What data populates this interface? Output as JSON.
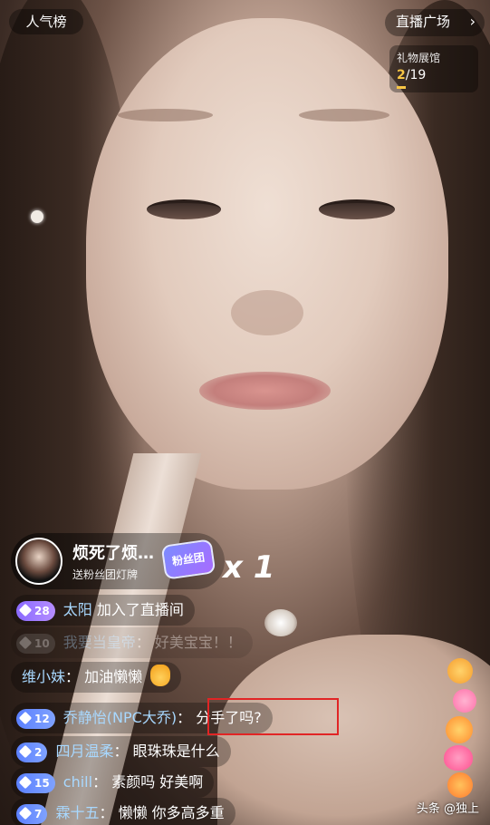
{
  "header": {
    "rank_label": "人气榜",
    "plaza_label": "直播广场",
    "plaza_chevron": "chevron-right-icon"
  },
  "gift_hall": {
    "title": "礼物展馆",
    "current": "2",
    "total": "/19",
    "accent": "#f7c645"
  },
  "gift_banner": {
    "sender": "烦死了烦…",
    "description": "送粉丝团灯牌",
    "badge": "粉丝团",
    "multiplier": "x 1"
  },
  "chat": [
    {
      "level": "28",
      "user": "太阳",
      "sep": "",
      "message": "加入了直播间",
      "level_color": "purple"
    },
    {
      "level": "10",
      "user": "我要当皇帝",
      "sep": "：",
      "message": "好美宝宝！！",
      "level_color": "gray",
      "faded": true
    },
    {
      "level": "",
      "user": "维小妹",
      "sep": "：",
      "message": "加油懒懒",
      "emoji": "hand-heart-icon"
    },
    {
      "level": "12",
      "user": "乔静怡(NPC大乔)",
      "sep": "：",
      "message": "分手了吗?",
      "level_color": "blue"
    },
    {
      "level": "2",
      "user": "四月温柔",
      "sep": "：",
      "message": "眼珠珠是什么",
      "level_color": "blue"
    },
    {
      "level": "15",
      "user": "chill",
      "sep": "：",
      "message": "素颜吗 好美啊",
      "level_color": "blue"
    },
    {
      "level": "7",
      "user": "霖十五",
      "sep": "：",
      "message": "懒懒 你多高多重",
      "level_color": "blue"
    }
  ],
  "watermark": "头条 @独上",
  "colors": {
    "username": "#a8d8ff",
    "highlight_border": "#e12525"
  }
}
